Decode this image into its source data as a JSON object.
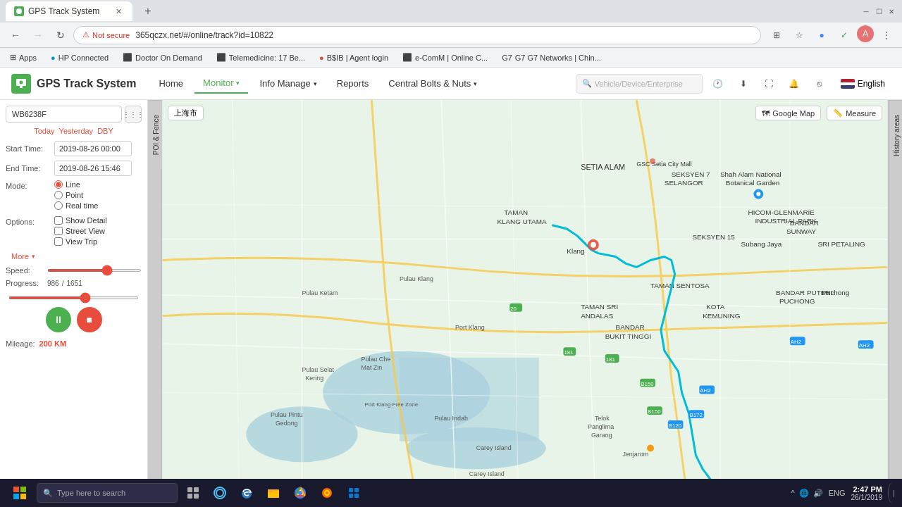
{
  "browser": {
    "tab_title": "GPS Track System",
    "tab_favicon": "GPS",
    "address": "365qczx.net/#/online/track?id=10822",
    "security_label": "Not secure",
    "bookmarks": [
      {
        "label": "Apps"
      },
      {
        "label": "HP Connected"
      },
      {
        "label": "Doctor On Demand"
      },
      {
        "label": "Telemedicine: 17 Be..."
      },
      {
        "label": "B$IB | Agent login"
      },
      {
        "label": "e-ComM | Online C..."
      },
      {
        "label": "G7  G7 Networks | Chin..."
      }
    ]
  },
  "app": {
    "title": "GPS Track System",
    "nav": [
      {
        "label": "Home",
        "active": false
      },
      {
        "label": "Monitor",
        "has_dropdown": true,
        "active": true
      },
      {
        "label": "Info Manage",
        "has_dropdown": true,
        "active": false
      },
      {
        "label": "Reports",
        "has_dropdown": false,
        "active": false
      },
      {
        "label": "Central Bolts & Nuts",
        "has_dropdown": true,
        "active": false
      }
    ],
    "search_placeholder": "Vehicle/Device/Enterprise",
    "lang": "English"
  },
  "sidebar": {
    "search_value": "WB6238F",
    "date_shortcuts": [
      "Today",
      "Yesterday",
      "DBY"
    ],
    "start_time_label": "Start Time:",
    "start_time_value": "2019-08-26 00:00",
    "end_time_label": "End Time:",
    "end_time_value": "2019-08-26 15:46",
    "mode_label": "Mode:",
    "modes": [
      {
        "label": "Line",
        "selected": true
      },
      {
        "label": "Point",
        "selected": false
      },
      {
        "label": "Real time",
        "selected": false
      }
    ],
    "options_label": "Options:",
    "options": [
      {
        "label": "Show Detail",
        "checked": false
      },
      {
        "label": "Street View",
        "checked": false
      },
      {
        "label": "View Trip",
        "checked": false
      }
    ],
    "more_label": "More",
    "speed_label": "Speed:",
    "speed_value": 65,
    "progress_label": "Progress:",
    "progress_numerator": "986",
    "progress_denominator": "1651",
    "progress_value": 60,
    "play_label": "▶",
    "stop_label": "■",
    "mileage_label": "Mileage:",
    "mileage_value": "200 KM"
  },
  "side_panels": [
    {
      "label": "POI & Fence"
    },
    {
      "label": "History areas"
    }
  ],
  "map": {
    "top_btn": "上海市",
    "google_map_label": "Google Map",
    "measure_label": "Measure"
  },
  "taskbar": {
    "search_placeholder": "Type here to search",
    "clock_time": "2:47 PM",
    "clock_date": "26/1/2019",
    "lang_indicator": "ENG"
  }
}
